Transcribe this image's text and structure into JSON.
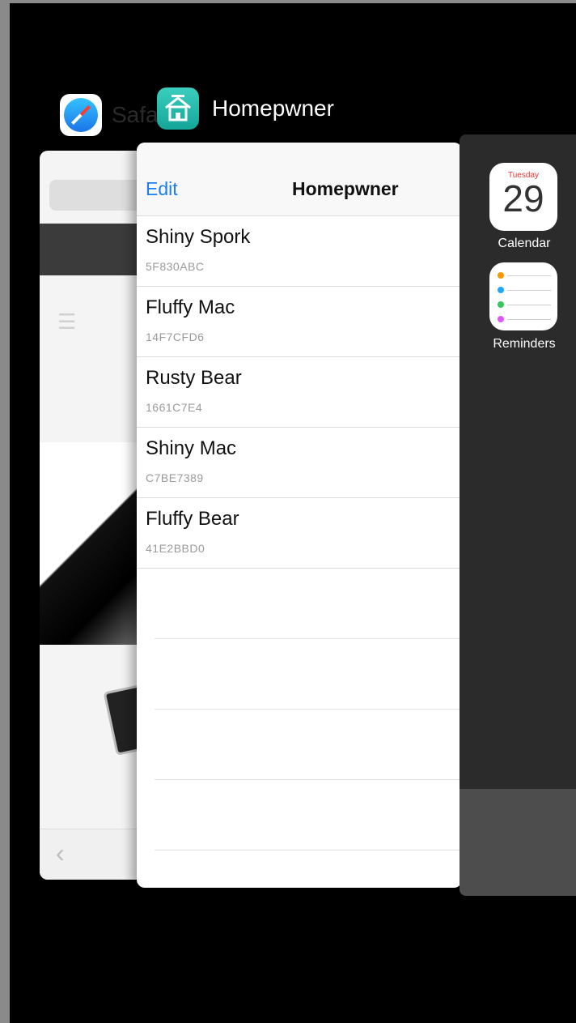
{
  "safari": {
    "app_name": "Safari",
    "icon": "safari-compass-icon"
  },
  "homepwner": {
    "app_name": "Homepwner",
    "icon": "house-icon",
    "nav": {
      "edit_label": "Edit",
      "title": "Homepwner"
    },
    "items": [
      {
        "name": "Shiny Spork",
        "serial": "5F830ABC"
      },
      {
        "name": "Fluffy Mac",
        "serial": "14F7CFD6"
      },
      {
        "name": "Rusty Bear",
        "serial": "1661C7E4"
      },
      {
        "name": "Shiny Mac",
        "serial": "C7BE7389"
      },
      {
        "name": "Fluffy Bear",
        "serial": "41E2BBD0"
      }
    ]
  },
  "dock": {
    "calendar": {
      "day_label": "Tuesday",
      "date": "29",
      "caption": "Calendar"
    },
    "reminders": {
      "caption": "Reminders",
      "dot_colors": [
        "#ff9500",
        "#1ea7ff",
        "#34c759",
        "#e056fd"
      ]
    }
  },
  "colors": {
    "accent": "#1b7ef5",
    "teal": "#18b3a4",
    "calendar_red": "#e53935"
  }
}
